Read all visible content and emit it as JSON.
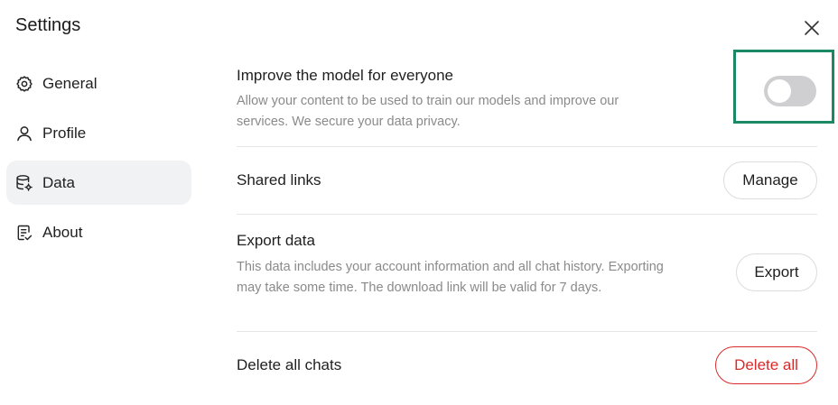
{
  "dialog": {
    "title": "Settings"
  },
  "sidebar": {
    "items": [
      {
        "label": "General",
        "icon": "gear-icon",
        "active": false
      },
      {
        "label": "Profile",
        "icon": "person-icon",
        "active": false
      },
      {
        "label": "Data",
        "icon": "database-gear-icon",
        "active": true
      },
      {
        "label": "About",
        "icon": "document-check-icon",
        "active": false
      }
    ]
  },
  "data_settings": {
    "improve_model": {
      "title": "Improve the model for everyone",
      "description": "Allow your content to be used to train our models and improve our services. We secure your data privacy.",
      "toggle_on": false
    },
    "shared_links": {
      "title": "Shared links",
      "button_label": "Manage"
    },
    "export_data": {
      "title": "Export data",
      "description": "This data includes your account information and all chat history. Exporting may take some time. The download link will be valid for 7 days.",
      "button_label": "Export"
    },
    "delete_chats": {
      "title": "Delete all chats",
      "button_label": "Delete all"
    }
  },
  "colors": {
    "accent_highlight": "#1a8a66",
    "danger": "#d92b2b",
    "toggle_off": "#cfcfd1",
    "active_nav_bg": "#f1f2f4"
  }
}
